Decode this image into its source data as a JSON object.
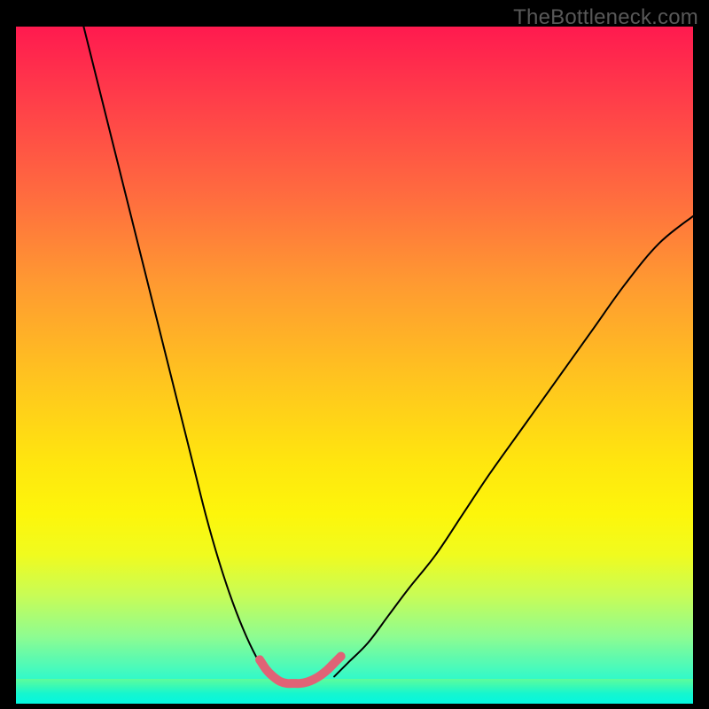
{
  "watermark": "TheBottleneck.com",
  "chart_data": {
    "type": "line",
    "title": "",
    "xlabel": "",
    "ylabel": "",
    "xlim": [
      0,
      100
    ],
    "ylim": [
      0,
      100
    ],
    "series": [
      {
        "name": "left-curve",
        "x": [
          10,
          12,
          14,
          16,
          18,
          20,
          22,
          24,
          26,
          28,
          30,
          32,
          34,
          36,
          37.5
        ],
        "y": [
          100,
          92,
          84,
          76,
          68,
          60,
          52,
          44,
          36,
          28,
          21,
          15,
          10,
          6,
          4
        ],
        "stroke": "#000000",
        "width": 2
      },
      {
        "name": "right-curve",
        "x": [
          47,
          49,
          52,
          55,
          58,
          62,
          66,
          70,
          75,
          80,
          85,
          90,
          95,
          100
        ],
        "y": [
          4,
          6,
          9,
          13,
          17,
          22,
          28,
          34,
          41,
          48,
          55,
          62,
          68,
          72
        ],
        "stroke": "#000000",
        "width": 2
      },
      {
        "name": "bottom-highlight",
        "x": [
          36,
          37,
          38,
          39,
          40,
          41,
          42,
          43,
          44,
          45,
          46,
          47,
          48
        ],
        "y": [
          6.5,
          5,
          4,
          3.3,
          3,
          3,
          3,
          3.2,
          3.6,
          4.2,
          5,
          6,
          7
        ],
        "stroke": "#e06376",
        "width": 10
      }
    ],
    "gradient_stops": [
      {
        "pos": 0,
        "color": "#ff1a4f"
      },
      {
        "pos": 25,
        "color": "#ff6c3f"
      },
      {
        "pos": 50,
        "color": "#ffc41f"
      },
      {
        "pos": 72,
        "color": "#fdf60b"
      },
      {
        "pos": 90,
        "color": "#8ffc90"
      },
      {
        "pos": 100,
        "color": "#04f7e0"
      }
    ]
  }
}
